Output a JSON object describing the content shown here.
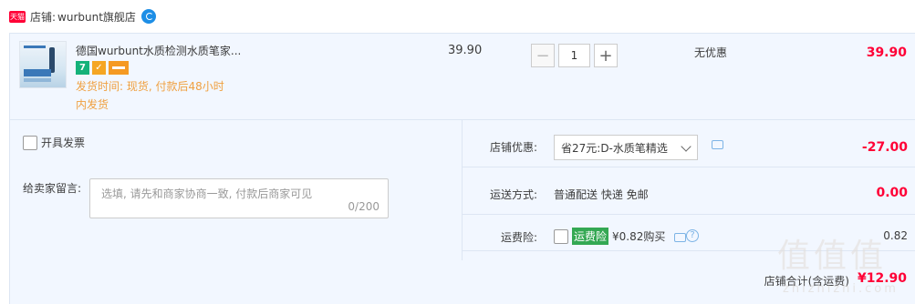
{
  "shop": {
    "badge": "天猫",
    "prefix": "店铺:",
    "name": "wurbunt旗舰店",
    "chat_icon": "wangwang-chat-icon"
  },
  "item": {
    "title": "德国wurbunt水质检测水质笔家...",
    "badges": [
      "7",
      "✓"
    ],
    "ship_time": "发货时间: 现货, 付款后48小时",
    "ship_time2": "内发货",
    "unit_price": "39.90",
    "quantity": "1",
    "promo": "无优惠",
    "total": "39.90"
  },
  "options": {
    "invoice_label": "开具发票",
    "note_label": "给卖家留言:",
    "note_placeholder": "选填, 请先和商家协商一致, 付款后商家可见",
    "note_count": "0/200",
    "coupon_label": "店铺优惠:",
    "coupon_value": "省27元:D-水质笔精选",
    "coupon_discount": "-27.00",
    "shipping_label": "运送方式:",
    "shipping_method": "普通配送 快递 免邮",
    "shipping_cost": "0.00",
    "insurance_label": "运费险:",
    "insurance_tag": "运费险",
    "insurance_text": "¥0.82购买",
    "insurance_price": "0.82"
  },
  "summary": {
    "label": "店铺合计(含运费)",
    "total": "¥12.90"
  },
  "watermark": {
    "text": "值值值",
    "url": "zhizhizhi.com"
  },
  "colors": {
    "price_red": "#ff0036",
    "row_bg": "#f2f7ff",
    "ship_orange": "#f0a040",
    "insurance_green": "#34a853"
  }
}
